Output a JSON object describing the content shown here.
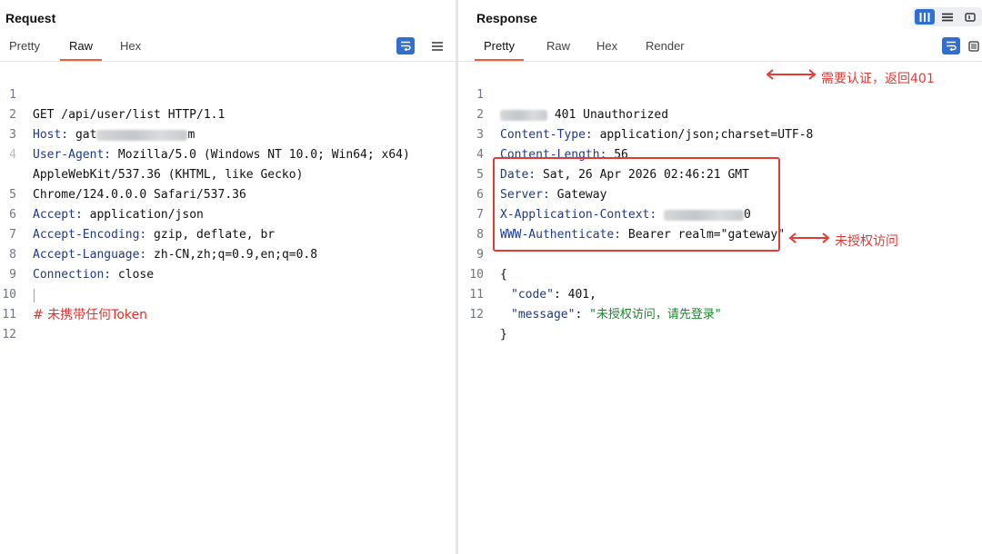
{
  "request": {
    "title": "Request",
    "tabs": [
      {
        "label": "Pretty",
        "active": false
      },
      {
        "label": "Raw",
        "active": true
      },
      {
        "label": "Hex",
        "active": false
      }
    ],
    "lines": [
      {
        "num": "1",
        "key": "",
        "val": "GET /api/user/list HTTP/1.1"
      },
      {
        "num": "2",
        "key": "Host:",
        "val": " gat",
        "tail": "m"
      },
      {
        "num": "3",
        "key": "User-Agent:",
        "val": " Mozilla/5.0 (Windows NT 10.0; Win64; x64)"
      },
      {
        "num": "4",
        "key": "",
        "val": "AppleWebKit/537.36 (KHTML, like Gecko)"
      },
      {
        "num": "",
        "key": "",
        "val": "Chrome/124.0.0.0 Safari/537.36"
      },
      {
        "num": "5",
        "key": "Accept:",
        "val": " application/json"
      },
      {
        "num": "6",
        "key": "Accept-Encoding:",
        "val": " gzip, deflate, br"
      },
      {
        "num": "7",
        "key": "Accept-Language:",
        "val": " zh-CN,zh;q=0.9,en;q=0.8"
      },
      {
        "num": "8",
        "key": "Connection:",
        "val": " close"
      },
      {
        "num": "9",
        "key": "",
        "val": ""
      },
      {
        "num": "10",
        "key": "",
        "val": "# 未携带任何Token"
      },
      {
        "num": "11",
        "key": "",
        "val": ""
      },
      {
        "num": "12",
        "key": "",
        "val": ""
      }
    ]
  },
  "response": {
    "title": "Response",
    "tabs": [
      {
        "label": "Pretty",
        "active": true
      },
      {
        "label": "Raw",
        "active": false
      },
      {
        "label": "Hex",
        "active": false
      },
      {
        "label": "Render",
        "active": false
      }
    ],
    "lines": [
      {
        "num": "1",
        "key": "",
        "val": " 401 Unauthorized"
      },
      {
        "num": "2",
        "key": "Content-Type:",
        "val": " application/json;charset=UTF-8"
      },
      {
        "num": "3",
        "key": "Content-Length:",
        "val": " 56"
      },
      {
        "num": "4",
        "key": "Date:",
        "val": " Sat, 26 Apr 2026 02:46:21 GMT"
      },
      {
        "num": "5",
        "key": "Server:",
        "val": " Gateway"
      },
      {
        "num": "6",
        "key": "X-Application-Context:",
        "val": " ",
        "tail": "0"
      },
      {
        "num": "7",
        "key": "WWW-Authenticate:",
        "val": " Bearer realm=\"gateway\""
      },
      {
        "num": "8",
        "key": "",
        "val": ""
      },
      {
        "num": "9",
        "key": "",
        "val": "{"
      },
      {
        "num": "10",
        "key": "",
        "val": ""
      },
      {
        "num": "11",
        "key": "",
        "val": ""
      },
      {
        "num": "12",
        "key": "",
        "val": "}"
      }
    ],
    "json_body": {
      "code_key": "\"code\"",
      "code_val": "401,",
      "message_key": "\"message\"",
      "message_val": "\"未授权访问，请先登录\""
    },
    "annotations": {
      "status_note": "需要认证，返回401",
      "body_note": "未授权访问"
    }
  },
  "colors": {
    "accent": "#2f6fd1",
    "tab_underline": "#e8613a",
    "annotation": "#e53935",
    "header_key": "#1e3a8a",
    "json_string": "#1a8a2e"
  }
}
